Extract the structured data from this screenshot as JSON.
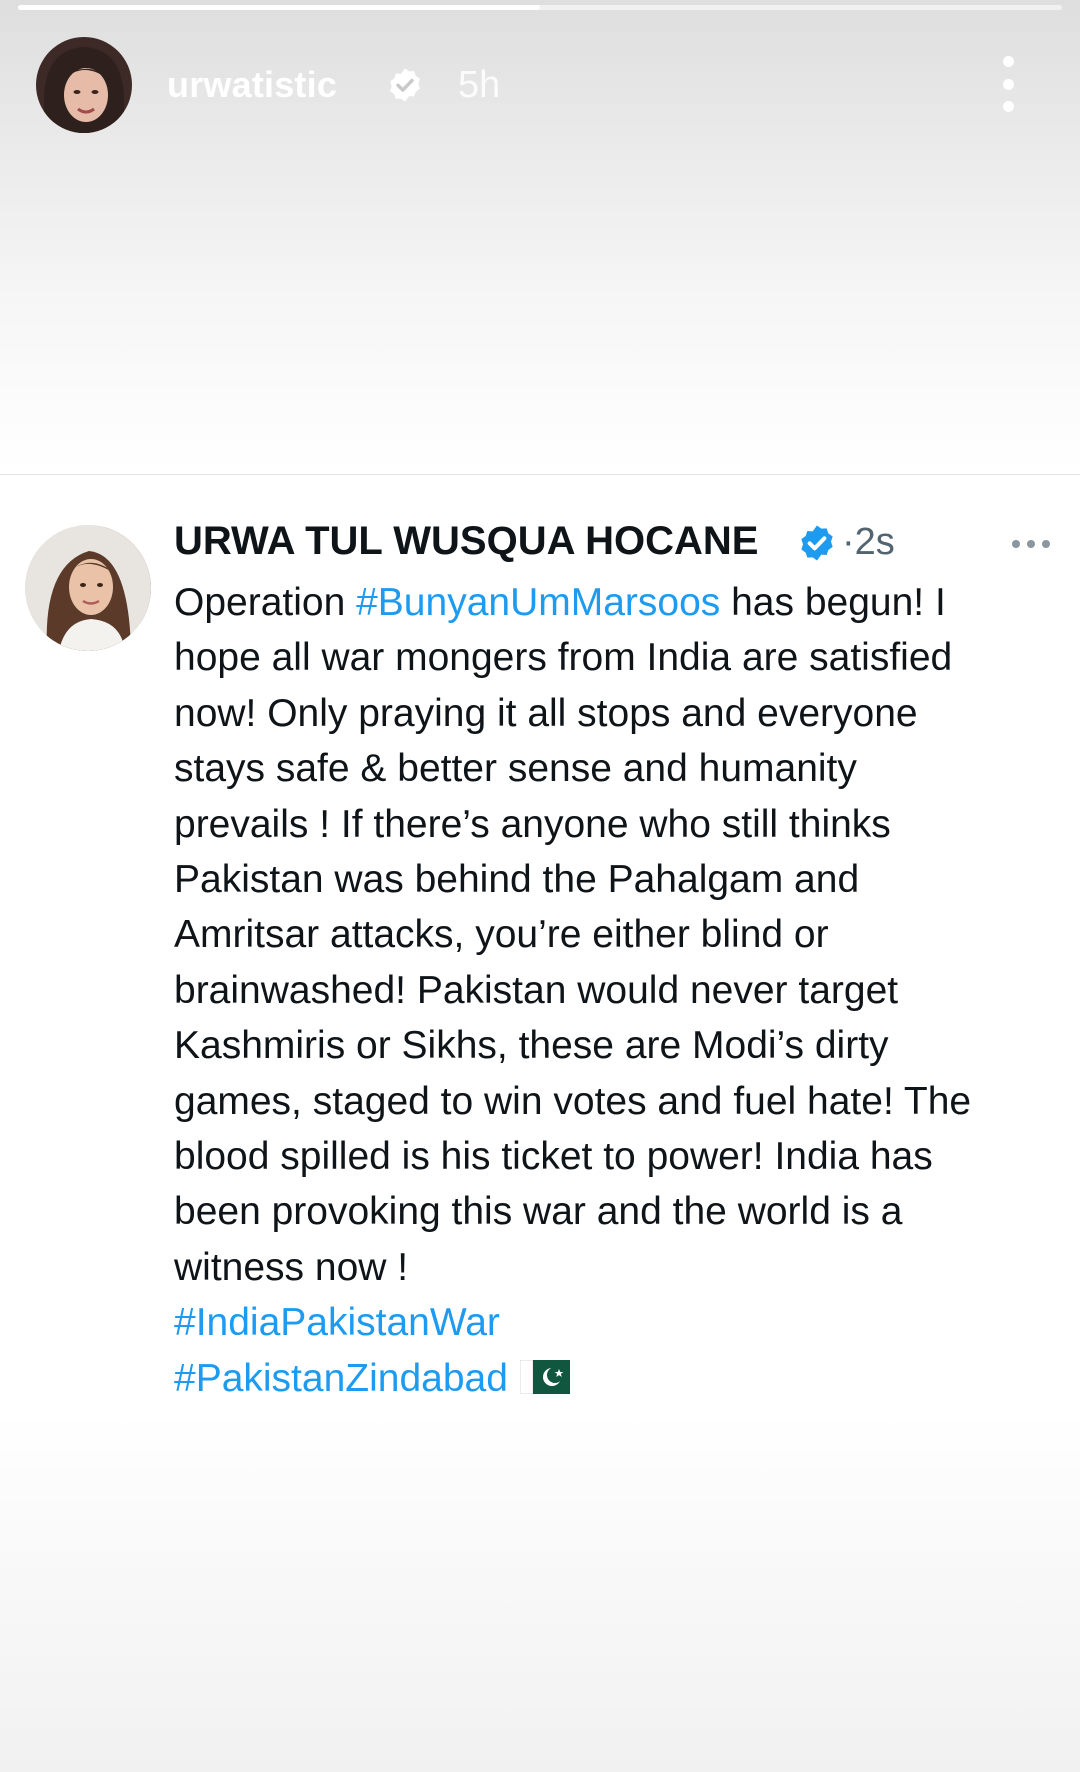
{
  "story": {
    "progress_fraction": 0.5,
    "username": "urwatistic",
    "time": "5h",
    "icons": {
      "verified": "verified-badge-icon",
      "more": "more-vertical-icon"
    }
  },
  "tweet": {
    "display_name": "URWA TUL WUSQUA HOCANE",
    "separator": "·",
    "time": "2s",
    "accent_color": "#1d9bf0",
    "verified_color": "#1d9bf0",
    "icons": {
      "verified": "verified-badge-icon",
      "more": "more-horizontal-icon",
      "flag": "pakistan-flag-icon"
    },
    "text_line1_prefix": "Operation ",
    "hashtag1": "#BunyanUmMarsoos",
    "text_line1_suffix": " has begun! I",
    "text_lines": [
      "hope all war mongers from India are satisfied",
      "now! Only praying it all stops and everyone",
      "stays safe & better sense and humanity",
      "prevails ! If there’s anyone who still thinks",
      "Pakistan was behind the Pahalgam and",
      "Amritsar attacks, you’re either blind or",
      "brainwashed! Pakistan would never target",
      "Kashmiris or Sikhs, these are Modi’s dirty",
      "games, staged to win votes and fuel hate! The",
      "blood spilled is his ticket to power! India has",
      "been provoking this war and the world is a",
      "witness now !"
    ],
    "hashtag2": "#IndiaPakistanWar",
    "hashtag3": "#PakistanZindabad"
  }
}
